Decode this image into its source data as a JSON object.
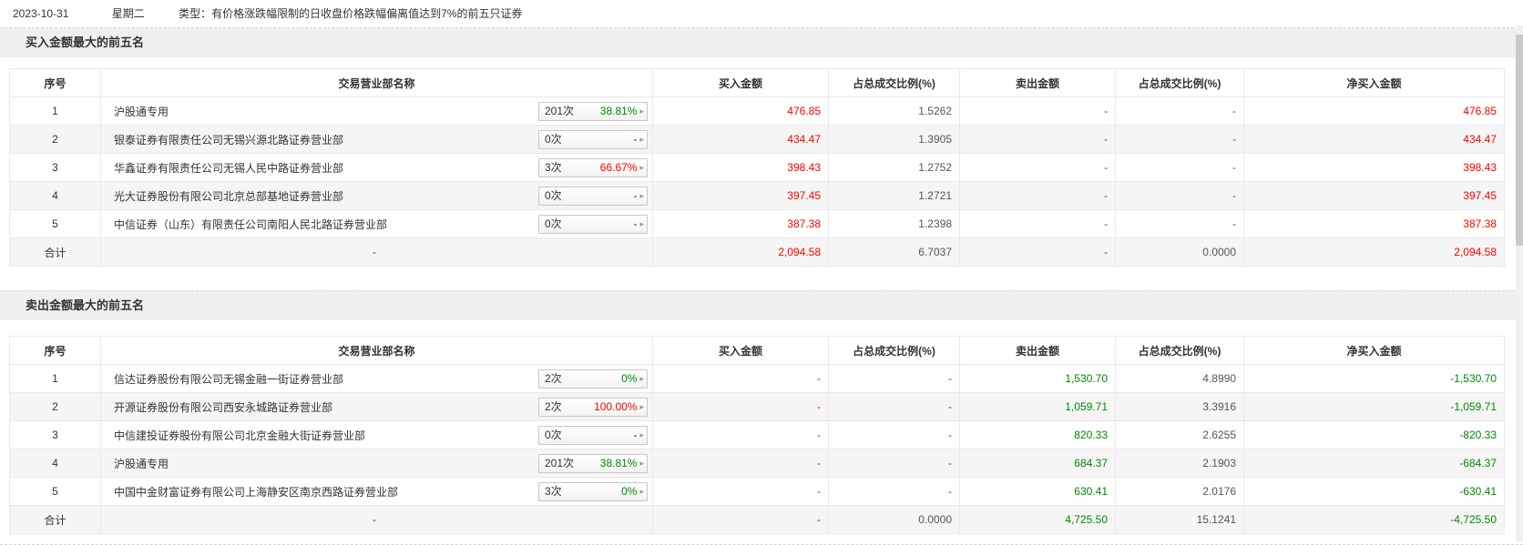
{
  "palette": {
    "red": "#fe0000",
    "green": "#008800",
    "gray": "#555555"
  },
  "icons": {
    "caret_right": "▸"
  },
  "topbar": {
    "date": "2023-10-31",
    "weekday": "星期二",
    "type_label": "类型：",
    "type_text": "有价格涨跌幅限制的日收盘价格跌幅偏离值达到7%的前五只证券"
  },
  "columns": [
    "序号",
    "交易营业部名称",
    "买入金额",
    "占总成交比例(%)",
    "卖出金额",
    "占总成交比例(%)",
    "净买入金额"
  ],
  "buy_section": {
    "title": "买入金额最大的前五名",
    "rows": [
      {
        "seq": "1",
        "name": "沪股通专用",
        "badge": {
          "count": "201次",
          "pct": "38.81%",
          "pct_color": "green"
        },
        "cells": [
          {
            "v": "476.85",
            "c": "red"
          },
          {
            "v": "1.5262",
            "c": "gray"
          },
          {
            "v": "-",
            "c": "green"
          },
          {
            "v": "-",
            "c": "gray"
          },
          {
            "v": "476.85",
            "c": "red"
          }
        ]
      },
      {
        "seq": "2",
        "name": "银泰证券有限责任公司无锡兴源北路证券营业部",
        "badge": {
          "count": "0次",
          "pct": "-",
          "pct_color": "dark"
        },
        "cells": [
          {
            "v": "434.47",
            "c": "red"
          },
          {
            "v": "1.3905",
            "c": "gray"
          },
          {
            "v": "-",
            "c": "green"
          },
          {
            "v": "-",
            "c": "gray"
          },
          {
            "v": "434.47",
            "c": "red"
          }
        ]
      },
      {
        "seq": "3",
        "name": "华鑫证券有限责任公司无锡人民中路证券营业部",
        "badge": {
          "count": "3次",
          "pct": "66.67%",
          "pct_color": "red"
        },
        "cells": [
          {
            "v": "398.43",
            "c": "red"
          },
          {
            "v": "1.2752",
            "c": "gray"
          },
          {
            "v": "-",
            "c": "green"
          },
          {
            "v": "-",
            "c": "gray"
          },
          {
            "v": "398.43",
            "c": "red"
          }
        ]
      },
      {
        "seq": "4",
        "name": "光大证券股份有限公司北京总部基地证券营业部",
        "badge": {
          "count": "0次",
          "pct": "-",
          "pct_color": "dark"
        },
        "cells": [
          {
            "v": "397.45",
            "c": "red"
          },
          {
            "v": "1.2721",
            "c": "gray"
          },
          {
            "v": "-",
            "c": "green"
          },
          {
            "v": "-",
            "c": "gray"
          },
          {
            "v": "397.45",
            "c": "red"
          }
        ]
      },
      {
        "seq": "5",
        "name": "中信证券（山东）有限责任公司南阳人民北路证券营业部",
        "badge": {
          "count": "0次",
          "pct": "-",
          "pct_color": "dark"
        },
        "cells": [
          {
            "v": "387.38",
            "c": "red"
          },
          {
            "v": "1.2398",
            "c": "gray"
          },
          {
            "v": "-",
            "c": "green"
          },
          {
            "v": "-",
            "c": "gray"
          },
          {
            "v": "387.38",
            "c": "red"
          }
        ]
      }
    ],
    "total": {
      "seq": "合计",
      "name": "-",
      "cells": [
        {
          "v": "2,094.58",
          "c": "red"
        },
        {
          "v": "6.7037",
          "c": "gray"
        },
        {
          "v": "-",
          "c": "green"
        },
        {
          "v": "0.0000",
          "c": "gray"
        },
        {
          "v": "2,094.58",
          "c": "red"
        }
      ]
    }
  },
  "sell_section": {
    "title": "卖出金额最大的前五名",
    "rows": [
      {
        "seq": "1",
        "name": "信达证券股份有限公司无锡金融一街证券营业部",
        "badge": {
          "count": "2次",
          "pct": "0%",
          "pct_color": "green"
        },
        "cells": [
          {
            "v": "-",
            "c": "red"
          },
          {
            "v": "-",
            "c": "red"
          },
          {
            "v": "1,530.70",
            "c": "green"
          },
          {
            "v": "4.8990",
            "c": "gray"
          },
          {
            "v": "-1,530.70",
            "c": "green"
          }
        ]
      },
      {
        "seq": "2",
        "name": "开源证券股份有限公司西安永城路证券营业部",
        "badge": {
          "count": "2次",
          "pct": "100.00%",
          "pct_color": "red"
        },
        "cells": [
          {
            "v": "-",
            "c": "red"
          },
          {
            "v": "-",
            "c": "red"
          },
          {
            "v": "1,059.71",
            "c": "green"
          },
          {
            "v": "3.3916",
            "c": "gray"
          },
          {
            "v": "-1,059.71",
            "c": "green"
          }
        ]
      },
      {
        "seq": "3",
        "name": "中信建投证券股份有限公司北京金融大街证券营业部",
        "badge": {
          "count": "0次",
          "pct": "-",
          "pct_color": "dark"
        },
        "cells": [
          {
            "v": "-",
            "c": "red"
          },
          {
            "v": "-",
            "c": "red"
          },
          {
            "v": "820.33",
            "c": "green"
          },
          {
            "v": "2.6255",
            "c": "gray"
          },
          {
            "v": "-820.33",
            "c": "green"
          }
        ]
      },
      {
        "seq": "4",
        "name": "沪股通专用",
        "badge": {
          "count": "201次",
          "pct": "38.81%",
          "pct_color": "green"
        },
        "cells": [
          {
            "v": "-",
            "c": "red"
          },
          {
            "v": "-",
            "c": "red"
          },
          {
            "v": "684.37",
            "c": "green"
          },
          {
            "v": "2.1903",
            "c": "gray"
          },
          {
            "v": "-684.37",
            "c": "green"
          }
        ]
      },
      {
        "seq": "5",
        "name": "中国中金财富证券有限公司上海静安区南京西路证券营业部",
        "badge": {
          "count": "3次",
          "pct": "0%",
          "pct_color": "green"
        },
        "cells": [
          {
            "v": "-",
            "c": "red"
          },
          {
            "v": "-",
            "c": "red"
          },
          {
            "v": "630.41",
            "c": "green"
          },
          {
            "v": "2.0176",
            "c": "gray"
          },
          {
            "v": "-630.41",
            "c": "green"
          }
        ]
      }
    ],
    "total": {
      "seq": "合计",
      "name": "-",
      "cells": [
        {
          "v": "-",
          "c": "red"
        },
        {
          "v": "0.0000",
          "c": "gray"
        },
        {
          "v": "4,725.50",
          "c": "green"
        },
        {
          "v": "15.1241",
          "c": "gray"
        },
        {
          "v": "-4,725.50",
          "c": "green"
        }
      ]
    }
  }
}
